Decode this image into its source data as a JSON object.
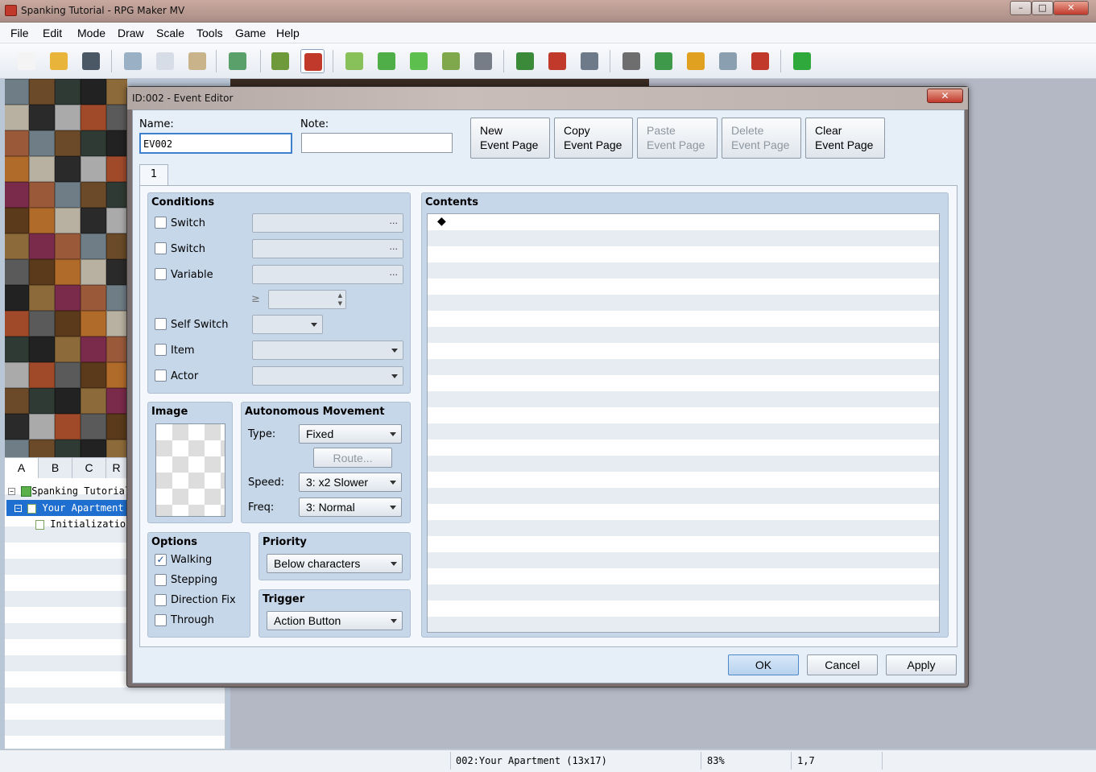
{
  "window": {
    "title": "Spanking Tutorial - RPG Maker MV",
    "min": "–",
    "max": "□",
    "close": "✕"
  },
  "menu": [
    "File",
    "Edit",
    "Mode",
    "Draw",
    "Scale",
    "Tools",
    "Game",
    "Help"
  ],
  "toolbar": [
    {
      "name": "new-project-icon",
      "color": "#f4f4f4"
    },
    {
      "name": "open-project-icon",
      "color": "#e8b53a"
    },
    {
      "name": "save-project-icon",
      "color": "#4a5866"
    },
    {
      "name": "cut-icon",
      "color": "#9ab0c4"
    },
    {
      "name": "copy-icon",
      "color": "#d6dde6"
    },
    {
      "name": "paste-icon",
      "color": "#c9b38a"
    },
    {
      "name": "undo-icon",
      "color": "#5aa06a"
    },
    {
      "name": "map-mode-icon",
      "color": "#6f9a3b"
    },
    {
      "name": "event-mode-icon",
      "color": "#c0392b"
    },
    {
      "name": "pencil-icon",
      "color": "#88c05a"
    },
    {
      "name": "rectangle-icon",
      "color": "#4fae48"
    },
    {
      "name": "ellipse-icon",
      "color": "#5cbf4e"
    },
    {
      "name": "flood-fill-icon",
      "color": "#7fa84c"
    },
    {
      "name": "shadow-pen-icon",
      "color": "#777d86"
    },
    {
      "name": "zoom-in-icon",
      "color": "#3a8a3a"
    },
    {
      "name": "zoom-out-icon",
      "color": "#c0392b"
    },
    {
      "name": "actual-size-icon",
      "color": "#6c7a8a"
    },
    {
      "name": "database-icon",
      "color": "#6e6e6e"
    },
    {
      "name": "plugin-manager-icon",
      "color": "#3e9a4a"
    },
    {
      "name": "sound-test-icon",
      "color": "#e0a020"
    },
    {
      "name": "event-searcher-icon",
      "color": "#8aa0b0"
    },
    {
      "name": "character-generator-icon",
      "color": "#c0392b"
    },
    {
      "name": "playtest-icon",
      "color": "#2fa83c"
    }
  ],
  "tileset_tabs": [
    "A",
    "B",
    "C",
    "R"
  ],
  "map_tree": {
    "project": "Spanking Tutorial",
    "map": "Your Apartment",
    "child": "Initialization"
  },
  "status": {
    "map": "002:Your Apartment (13x17)",
    "zoom": "83%",
    "coords": "1,7"
  },
  "dialog": {
    "title": "ID:002 - Event Editor",
    "close": "✕",
    "name_label": "Name:",
    "name_value": "EV002",
    "note_label": "Note:",
    "note_value": "",
    "buttons": [
      {
        "line1": "New",
        "line2": "Event Page",
        "enabled": true
      },
      {
        "line1": "Copy",
        "line2": "Event Page",
        "enabled": true
      },
      {
        "line1": "Paste",
        "line2": "Event Page",
        "enabled": false
      },
      {
        "line1": "Delete",
        "line2": "Event Page",
        "enabled": false
      },
      {
        "line1": "Clear",
        "line2": "Event Page",
        "enabled": true
      }
    ],
    "page_tab": "1",
    "conditions": {
      "title": "Conditions",
      "switch1": "Switch",
      "switch2": "Switch",
      "variable": "Variable",
      "gte": "≥",
      "self_switch": "Self Switch",
      "item": "Item",
      "actor": "Actor",
      "dots": "..."
    },
    "image": {
      "title": "Image"
    },
    "movement": {
      "title": "Autonomous Movement",
      "type_label": "Type:",
      "type_value": "Fixed",
      "route": "Route...",
      "speed_label": "Speed:",
      "speed_value": "3: x2 Slower",
      "freq_label": "Freq:",
      "freq_value": "3: Normal"
    },
    "options": {
      "title": "Options",
      "walking": "Walking",
      "walking_checked": "✓",
      "stepping": "Stepping",
      "direction_fix": "Direction Fix",
      "through": "Through"
    },
    "priority": {
      "title": "Priority",
      "value": "Below characters"
    },
    "trigger": {
      "title": "Trigger",
      "value": "Action Button"
    },
    "contents": {
      "title": "Contents",
      "first_item": "◆"
    },
    "ok": "OK",
    "cancel": "Cancel",
    "apply": "Apply"
  }
}
